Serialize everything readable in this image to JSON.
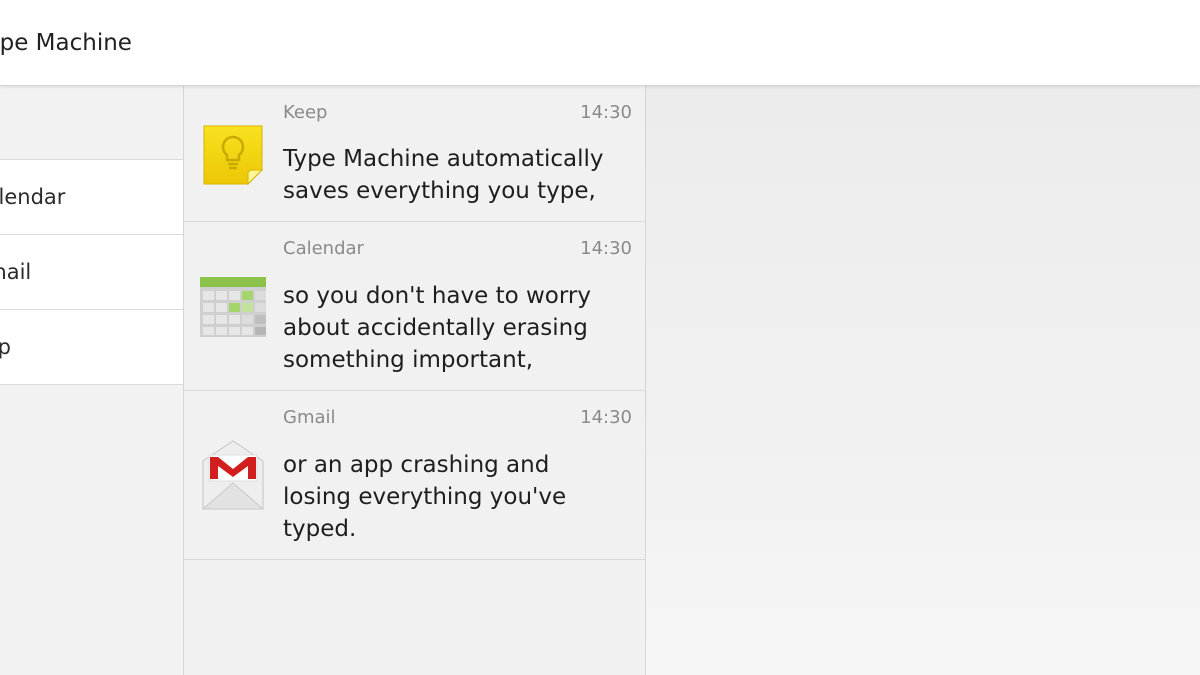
{
  "app": {
    "title": "ype Machine"
  },
  "sidebar": {
    "items": [
      {
        "label": "Calendar"
      },
      {
        "label": "Gmail"
      },
      {
        "label": "Keep"
      }
    ]
  },
  "notes": [
    {
      "app": "Keep",
      "time": "14:30",
      "text": "Type Machine automatically\nsaves everything you type,",
      "icon": "keep-icon"
    },
    {
      "app": "Calendar",
      "time": "14:30",
      "text": "so you don't have to worry\nabout accidentally erasing\nsomething important,",
      "icon": "calendar-icon"
    },
    {
      "app": "Gmail",
      "time": "14:30",
      "text": "or an app crashing and\nlosing everything you've\ntyped.",
      "icon": "gmail-icon"
    }
  ],
  "colors": {
    "keep_yellow": "#f4d80c",
    "calendar_green": "#8bc34a",
    "gmail_red": "#d11f1f"
  }
}
